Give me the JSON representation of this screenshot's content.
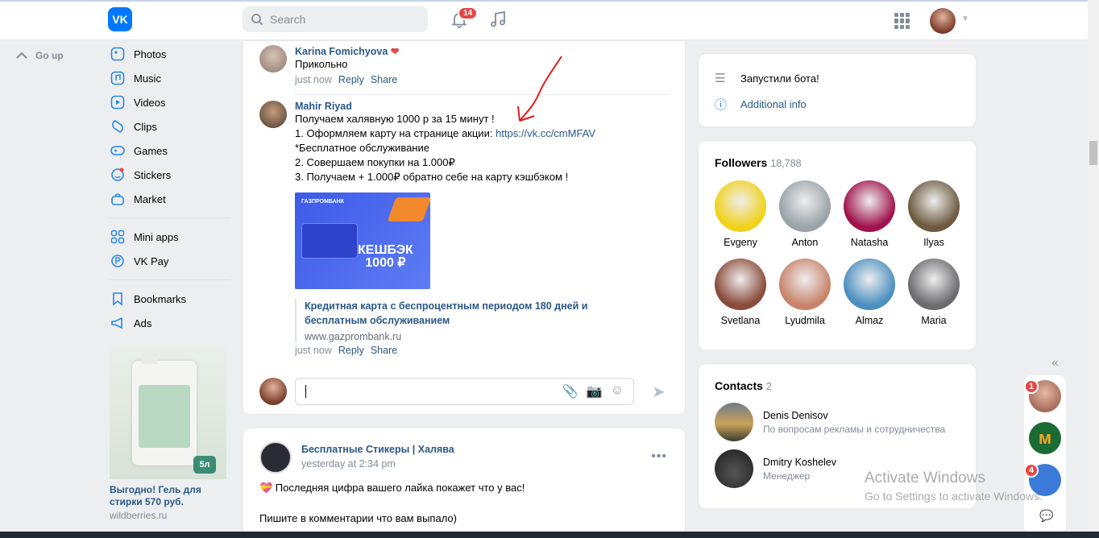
{
  "header": {
    "logo": "VK",
    "search_placeholder": "Search",
    "notifications_count": "14"
  },
  "left_nav": {
    "go_up": "Go up",
    "items": [
      {
        "label": "Photos",
        "icon": "photos-icon"
      },
      {
        "label": "Music",
        "icon": "music-icon"
      },
      {
        "label": "Videos",
        "icon": "videos-icon"
      },
      {
        "label": "Clips",
        "icon": "clips-icon"
      },
      {
        "label": "Games",
        "icon": "games-icon"
      },
      {
        "label": "Stickers",
        "icon": "stickers-icon"
      },
      {
        "label": "Market",
        "icon": "market-icon"
      },
      {
        "label": "Mini apps",
        "icon": "mini-apps-icon"
      },
      {
        "label": "VK Pay",
        "icon": "vk-pay-icon"
      },
      {
        "label": "Bookmarks",
        "icon": "bookmarks-icon"
      },
      {
        "label": "Ads",
        "icon": "ads-icon"
      }
    ],
    "ad": {
      "badge": "5л",
      "title": "Выгодно! Гель для стирки 570 руб.",
      "url": "wildberries.ru"
    }
  },
  "feed": {
    "comment1": {
      "author": "Karina Fomichyova",
      "text": "Прикольно",
      "time": "just now",
      "reply": "Reply",
      "share": "Share"
    },
    "comment2": {
      "author": "Mahir Riyad",
      "line1": "Получаем халявную 1000 р за 15 минут !",
      "line2_prefix": "1. Оформляем карту на странице акции: ",
      "line2_link": "https://vk.cc/cmMFAV",
      "line3": "*Бесплатное обслуживание",
      "line4": "2. Совершаем покупки на 1.000₽",
      "line5": "3. Получаем + 1.000₽ обратно себе на карту кэшбэком !",
      "banner_brand": "ГАЗПРОМБАНК",
      "banner_text1": "КЕШБЭК",
      "banner_text2": "1000 ₽",
      "link_title": "Кредитная карта с беспроцентным периодом 180 дней и бесплатным обслуживанием",
      "link_url": "www.gazprombank.ru",
      "time": "just now",
      "reply": "Reply",
      "share": "Share"
    },
    "post2": {
      "author": "Бесплатные Стикеры | Халява",
      "time": "yesterday at 2:34 pm",
      "text1": "💝 Последняя цифра вашего лайка покажет что у вас!",
      "text2": "Пишите в комментарии что вам выпало)"
    }
  },
  "right": {
    "info": {
      "status": "Запустили бота!",
      "more": "Additional info"
    },
    "followers": {
      "title": "Followers",
      "count": "18,788",
      "people": [
        {
          "name": "Evgeny",
          "color": "#f1d21b"
        },
        {
          "name": "Anton",
          "color": "#9aa3a8"
        },
        {
          "name": "Natasha",
          "color": "#a0124b"
        },
        {
          "name": "Ilyas",
          "color": "#6d5a3f"
        },
        {
          "name": "Svetlana",
          "color": "#8a4b3a"
        },
        {
          "name": "Lyudmila",
          "color": "#c8846a"
        },
        {
          "name": "Almaz",
          "color": "#4b8fc0"
        },
        {
          "name": "Maria",
          "color": "#6b6b70"
        }
      ]
    },
    "contacts": {
      "title": "Contacts",
      "count": "2",
      "people": [
        {
          "name": "Denis Denisov",
          "role": "По вопросам рекламы и сотрудничества"
        },
        {
          "name": "Dmitry Koshelev",
          "role": "Менеджер"
        }
      ]
    }
  },
  "dock": {
    "badge1": "1",
    "badge2": "4"
  },
  "watermark": {
    "line1": "Activate Windows",
    "line2": "Go to Settings to activate Windows."
  },
  "colors": {
    "accent": "#0077ff",
    "link": "#2a5885",
    "badge": "#e64646"
  }
}
